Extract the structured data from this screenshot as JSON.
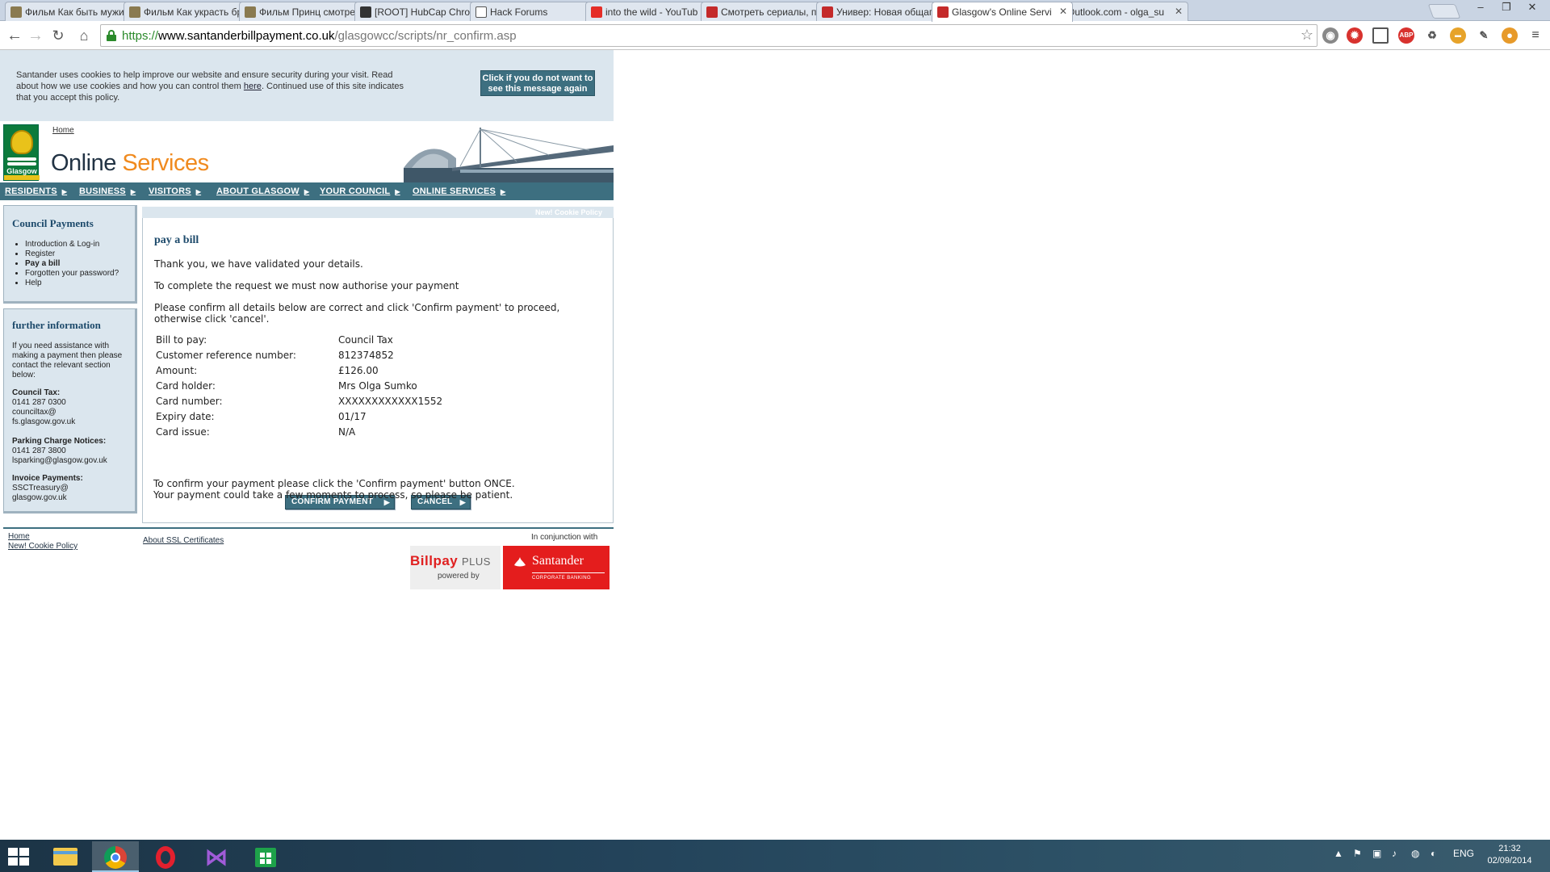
{
  "browser": {
    "tabs": [
      {
        "title": "Фильм Как быть мужи",
        "favicon_color": "#8a7a50"
      },
      {
        "title": "Фильм Как украсть бр",
        "favicon_color": "#8a7a50"
      },
      {
        "title": "Фильм Принц смотре",
        "favicon_color": "#8a7a50"
      },
      {
        "title": "[ROOT] HubCap Chrom",
        "favicon_color": "#333333"
      },
      {
        "title": "Hack Forums",
        "favicon_color": "#555555"
      },
      {
        "title": "into the wild - YouTub",
        "favicon_color": "#e52d27"
      },
      {
        "title": "Смотреть сериалы, по",
        "favicon_color": "#c42a2a"
      },
      {
        "title": "Универ: Новая общаг",
        "favicon_color": "#c42a2a"
      },
      {
        "title": "Glasgow's Online Servi",
        "favicon_color": "#c42a2a"
      },
      {
        "title": "Outlook.com - olga_su",
        "favicon_color": "#1f6fbf"
      }
    ],
    "active_tab_index": 8,
    "url": {
      "scheme": "https://",
      "host": "www.santanderbillpayment.co.uk",
      "path": "/glasgowcc/scripts/nr_confirm.asp"
    }
  },
  "cookie_notice": {
    "text_before": "Santander uses cookies to help improve our website and ensure security during your visit. Read about how we use cookies and how you can control them ",
    "link": "here",
    "text_after": ". Continued use of this site indicates that you accept this policy.",
    "button": "Click if you do not want to see this message again"
  },
  "header": {
    "logo_word": "Glasgow",
    "home_link": "Home",
    "title_main": "Online ",
    "title_accent": "Services"
  },
  "nav": [
    "RESIDENTS",
    "BUSINESS",
    "VISITORS",
    "ABOUT GLASGOW",
    "YOUR COUNCIL",
    "ONLINE SERVICES"
  ],
  "cookie_policy_strip": "New! Cookie Policy",
  "sidebar": {
    "council_payments": {
      "title": "Council Payments",
      "items": [
        "Introduction & Log-in",
        "Register",
        "Pay a bill",
        "Forgotten your password?",
        "Help"
      ],
      "current": "Pay a bill"
    },
    "further_info": {
      "title": "further information",
      "intro": "If you need assistance with making a payment then please contact the relevant section below:",
      "council_tax": {
        "label": "Council Tax:",
        "phone": "0141 287 0300",
        "email1": "counciltax@",
        "email2": "fs.glasgow.gov.uk"
      },
      "parking": {
        "label": "Parking Charge Notices:",
        "phone": "0141 287 3800",
        "email": "lsparking@glasgow.gov.uk"
      },
      "invoice": {
        "label": "Invoice Payments:",
        "email1": "SSCTreasury@",
        "email2": "glasgow.gov.uk"
      }
    }
  },
  "content": {
    "title": "pay a bill",
    "p1": "Thank you, we have validated your details.",
    "p2": "To complete the request we must now authorise your payment",
    "p3a": "Please confirm all details below are correct and click 'Confirm payment' to proceed,",
    "p3b": "otherwise click 'cancel'.",
    "details": [
      {
        "label": "Bill to pay:",
        "value": "Council Tax"
      },
      {
        "label": "Customer reference number:",
        "value": "812374852"
      },
      {
        "label": "Amount:",
        "value": "£126.00"
      },
      {
        "label": "Card holder:",
        "value": "Mrs Olga Sumko"
      },
      {
        "label": "Card number:",
        "value": "XXXXXXXXXXXX1552"
      },
      {
        "label": "Expiry date:",
        "value": "01/17"
      },
      {
        "label": "Card issue:",
        "value": "N/A"
      }
    ],
    "confirm_button": "CONFIRM PAYMENT",
    "cancel_button": "CANCEL",
    "note1": "To confirm your payment please click the 'Confirm payment' button ONCE.",
    "note2": "Your payment could take a few moments to process, so please be patient."
  },
  "footer": {
    "home": "Home",
    "cookie_policy": "New! Cookie Policy",
    "ssl": "About SSL Certificates",
    "conjunction": "In conjunction with",
    "billpay_main": "Billpay",
    "billpay_plus": "PLUS",
    "billpay_powered": "powered by",
    "santander": "Santander",
    "santander_sub": "CORPORATE BANKING"
  },
  "taskbar": {
    "language": "ENG",
    "time": "21:32",
    "date": "02/09/2014"
  },
  "colors": {
    "brand_teal": "#3d6f80",
    "panel_blue": "#dbe6ee",
    "heading_blue": "#1d4a6b",
    "accent_orange": "#f08a1e",
    "santander_red": "#e41d1d"
  }
}
